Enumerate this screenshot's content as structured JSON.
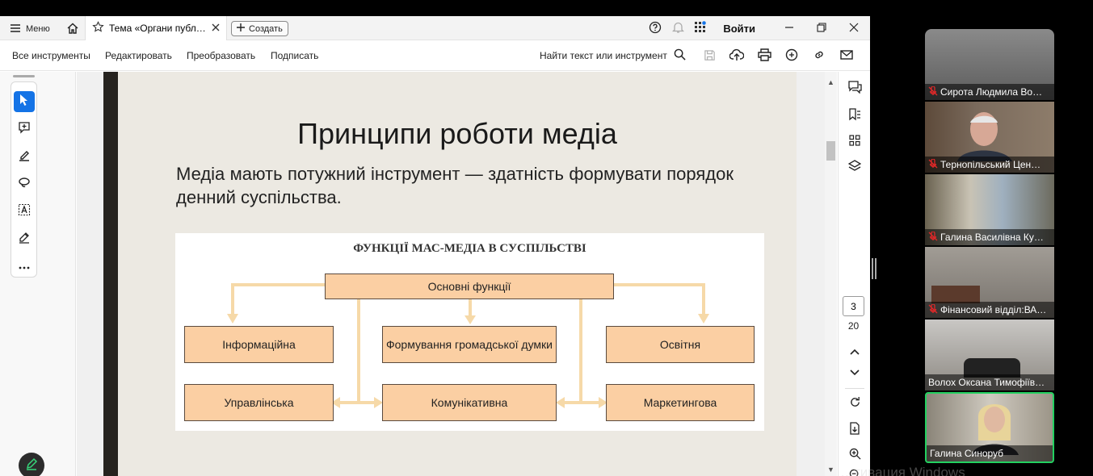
{
  "titlebar": {
    "menu_label": "Меню",
    "tab_title": "Тема «Органи публі…",
    "create_label": "Создать",
    "login_label": "Войти"
  },
  "toolbar": {
    "all_tools": "Все инструменты",
    "edit": "Редактировать",
    "convert": "Преобразовать",
    "sign": "Подписать",
    "find_label": "Найти текст или инструмент"
  },
  "slide": {
    "title": "Принципи роботи медіа",
    "body": "Медіа мають потужний інструмент — здатність формувати порядок денний суспільства.",
    "diagram": {
      "title": "ФУНКЦІЇ МАС-МЕДІА В СУСПІЛЬСТВІ",
      "root": "Основні функції",
      "boxes": [
        "Інформаційна",
        "Формування громадської думки",
        "Освітня",
        "Управлінська",
        "Комунікативна",
        "Маркетингова"
      ]
    }
  },
  "navigation": {
    "current_page": "3",
    "total_pages": "20"
  },
  "participants": [
    {
      "name": "Сирота Людмила Во…",
      "muted": true
    },
    {
      "name": "Тернопільський Цен…",
      "muted": true
    },
    {
      "name": "Галина Василівна Ку…",
      "muted": true
    },
    {
      "name": "Фінансовий відділ:ВА…",
      "muted": true
    },
    {
      "name": "Волох Оксана Тимофіїв…",
      "muted": false
    },
    {
      "name": "Галина Синоруб",
      "muted": false,
      "active_speaker": true
    }
  ],
  "watermark": "…тивация Windows",
  "colors": {
    "accent": "#1473e6",
    "box_fill": "#fbcfa3",
    "arrow": "#f6d9a8",
    "speaker_border": "#23d160",
    "mute_icon": "#e02828"
  }
}
